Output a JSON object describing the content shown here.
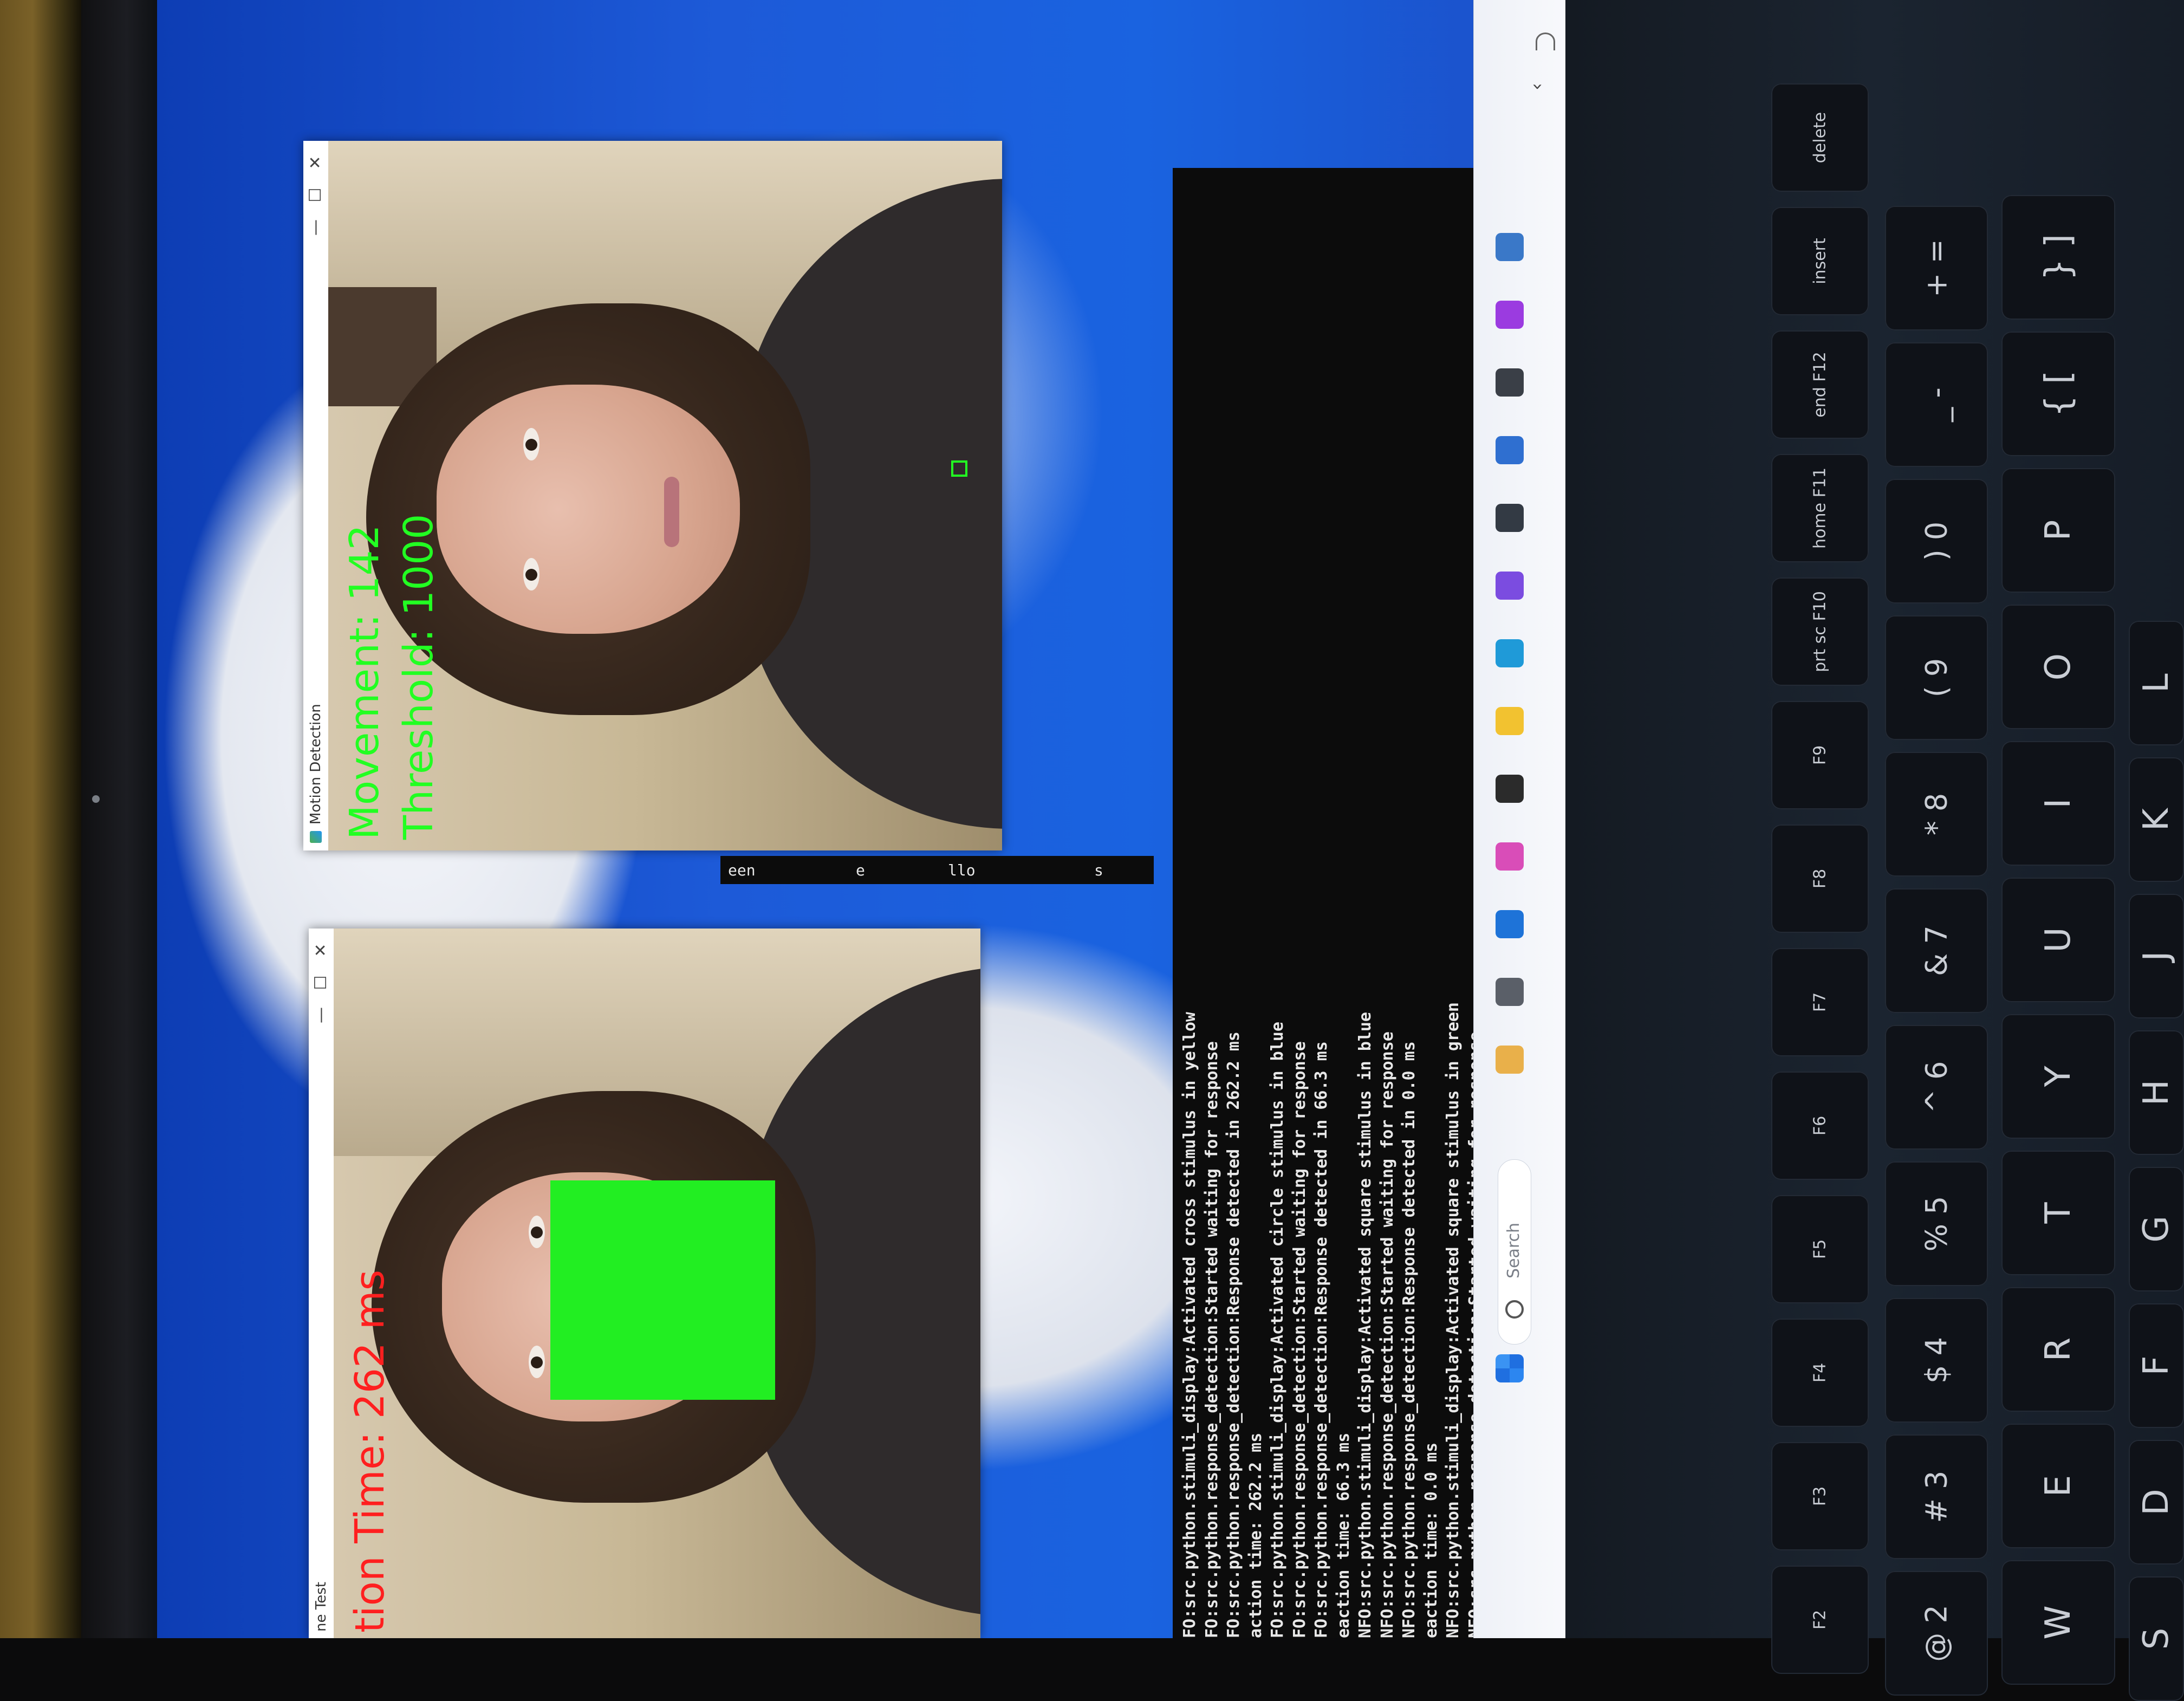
{
  "motion_window": {
    "title": "Motion Detection",
    "min": "—",
    "max": "☐",
    "close": "✕",
    "movement": "Movement: 142",
    "threshold": "Threshold: 1000"
  },
  "reaction_window": {
    "title": "ne Test",
    "min": "—",
    "max": "☐",
    "close": "✕",
    "reaction_time": "tion Time: 262 ms",
    "stimulus_color": "#22ee22"
  },
  "terminal": {
    "partial_lines": [
      "een",
      "e",
      "llo",
      "s"
    ],
    "log": [
      "FO:src.python.stimuli_display:Activated cross stimulus in yellow",
      "FO:src.python.response_detection:Started waiting for response",
      "FO:src.python.response_detection:Response detected in 262.2 ms",
      "action time: 262.2 ms",
      "FO:src.python.stimuli_display:Activated circle stimulus in blue",
      "FO:src.python.response_detection:Started waiting for response",
      "FO:src.python.response_detection:Response detected in 66.3 ms",
      "eaction time: 66.3 ms",
      "NFO:src.python.stimuli_display:Activated square stimulus in blue",
      "NFO:src.python.response_detection:Started waiting for response",
      "NFO:src.python.response_detection:Response detected in 0.0 ms",
      "eaction time: 0.0 ms",
      "NFO:src.python.stimuli_display:Activated square stimulus in green",
      "NFO:src.python.response_detection:Started waiting for response"
    ]
  },
  "taskbar": {
    "search_label": "Search",
    "apps": [
      {
        "icon": "wallpaper-app-icon",
        "color": "#e9b04a"
      },
      {
        "icon": "task-view-icon",
        "color": "#5a5f68"
      },
      {
        "icon": "dell-icon",
        "color": "#1e73d8"
      },
      {
        "icon": "copilot-icon",
        "color": "#d94db8"
      },
      {
        "icon": "terminal-icon",
        "color": "#2b2b2b"
      },
      {
        "icon": "file-explorer-icon",
        "color": "#f2c230"
      },
      {
        "icon": "edge-icon",
        "color": "#1f9ad8"
      },
      {
        "icon": "teams-icon",
        "color": "#7b4ce0"
      },
      {
        "icon": "text-app-icon",
        "color": "#333a44"
      },
      {
        "icon": "store-icon",
        "color": "#2f6fd0"
      },
      {
        "icon": "photos-icon",
        "color": "#3a3f47"
      },
      {
        "icon": "visual-studio-icon",
        "color": "#9b3be0"
      },
      {
        "icon": "python-icon",
        "color": "#3a78c8"
      }
    ]
  },
  "keyboard": {
    "function_row": [
      "F2",
      "F3",
      "F4",
      "F5",
      "F6",
      "F7",
      "F8",
      "F9",
      "prt sc F10",
      "home F11",
      "end F12",
      "insert",
      "delete"
    ],
    "number_row": [
      "@ 2",
      "# 3",
      "$ 4",
      "% 5",
      "^ 6",
      "& 7",
      "* 8",
      "( 9",
      ") 0",
      "_ -",
      "+ ="
    ],
    "letter_row": [
      "W",
      "E",
      "R",
      "T",
      "Y",
      "U",
      "I",
      "O",
      "P",
      "{ [",
      "} ]"
    ],
    "home_row": [
      "S",
      "D",
      "F",
      "G",
      "H",
      "J",
      "K",
      "L"
    ]
  }
}
